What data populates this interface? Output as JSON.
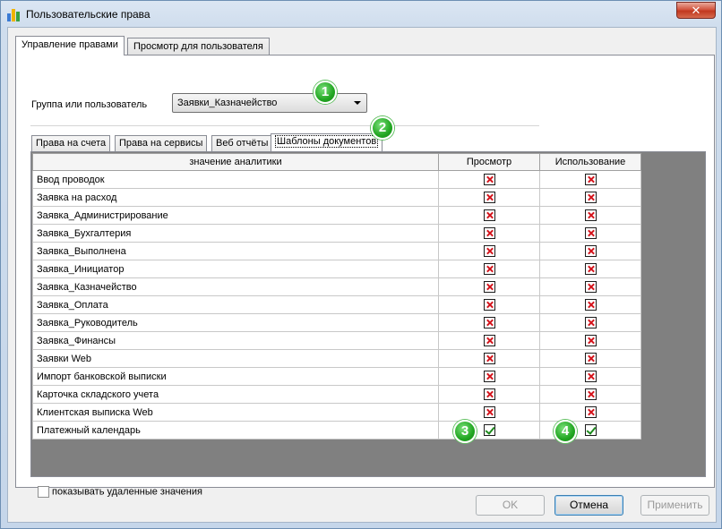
{
  "window": {
    "title": "Пользовательские права",
    "close_glyph": "✕"
  },
  "outer_tabs": [
    {
      "label": "Управление правами",
      "active": true
    },
    {
      "label": "Просмотр для пользователя",
      "active": false
    }
  ],
  "group": {
    "label": "Группа или пользователь",
    "selected_value": "Заявки_Казначейство"
  },
  "inner_tabs": [
    {
      "label": "Права на счета",
      "active": false
    },
    {
      "label": "Права на сервисы",
      "active": false
    },
    {
      "label": "Веб отчёты",
      "active": false
    },
    {
      "label": "Шаблоны документов",
      "active": true
    }
  ],
  "grid": {
    "columns": [
      "значение аналитики",
      "Просмотр",
      "Использование"
    ],
    "rows": [
      {
        "name": "Ввод проводок",
        "view": false,
        "use": false
      },
      {
        "name": "Заявка на расход",
        "view": false,
        "use": false
      },
      {
        "name": "Заявка_Администрирование",
        "view": false,
        "use": false
      },
      {
        "name": "Заявка_Бухгалтерия",
        "view": false,
        "use": false
      },
      {
        "name": "Заявка_Выполнена",
        "view": false,
        "use": false
      },
      {
        "name": "Заявка_Инициатор",
        "view": false,
        "use": false
      },
      {
        "name": "Заявка_Казначейство",
        "view": false,
        "use": false
      },
      {
        "name": "Заявка_Оплата",
        "view": false,
        "use": false
      },
      {
        "name": "Заявка_Руководитель",
        "view": false,
        "use": false
      },
      {
        "name": "Заявка_Финансы",
        "view": false,
        "use": false
      },
      {
        "name": "Заявки Web",
        "view": false,
        "use": false
      },
      {
        "name": "Импорт банковской выписки",
        "view": false,
        "use": false
      },
      {
        "name": "Карточка складского учета",
        "view": false,
        "use": false
      },
      {
        "name": "Клиентская выписка Web",
        "view": false,
        "use": false
      },
      {
        "name": "Платежный календарь",
        "view": true,
        "use": true
      }
    ]
  },
  "show_deleted": {
    "label": "показывать удаленные значения",
    "checked": false
  },
  "badges": [
    "1",
    "2",
    "3",
    "4"
  ],
  "buttons": {
    "ok": "OK",
    "cancel": "Отмена",
    "apply": "Применить"
  },
  "colors": {
    "badge_green": "#21a621",
    "cross_red": "#d4141c",
    "check_green": "#1d8a1d"
  }
}
